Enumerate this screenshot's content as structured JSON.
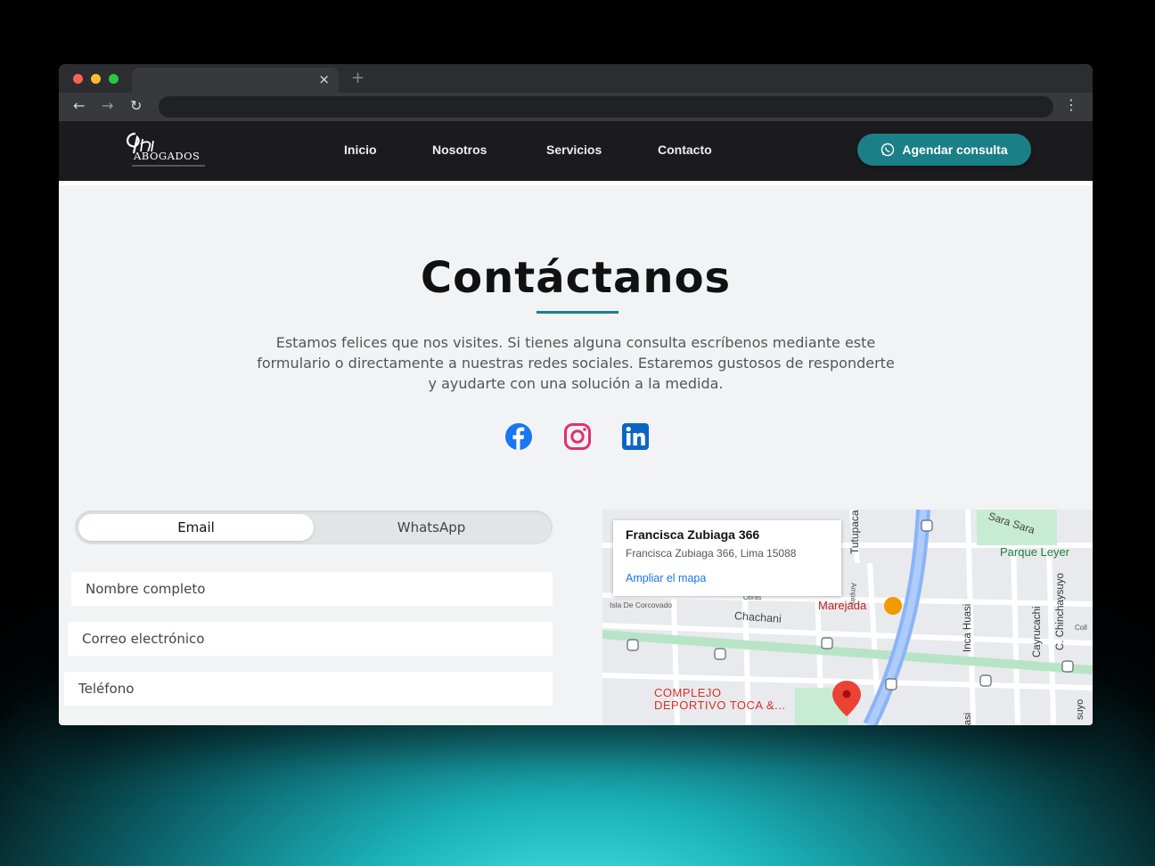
{
  "browser": {
    "tab_close": "×",
    "new_tab": "+",
    "back": "←",
    "forward": "→",
    "reload": "↻",
    "menu": "⋮"
  },
  "header": {
    "logo_text": "ABOGADOS",
    "nav": [
      "Inicio",
      "Nosotros",
      "Servicios",
      "Contacto"
    ],
    "cta_label": "Agendar consulta"
  },
  "main": {
    "title": "Contáctanos",
    "lead_lines": [
      "Estamos felices que nos visites. Si tienes alguna consulta escríbenos mediante este",
      "formulario o directamente a nuestras redes sociales. Estaremos gustosos de responderte",
      "y ayudarte con una solución a la medida."
    ],
    "social": [
      "facebook-icon",
      "instagram-icon",
      "linkedin-icon"
    ]
  },
  "form": {
    "toggle": [
      "Email",
      "WhatsApp"
    ],
    "active_tab": "Email",
    "fields": [
      "Nombre completo",
      "Correo electrónico",
      "Teléfono"
    ]
  },
  "map": {
    "place_title": "Francisca Zubiaga 366",
    "place_address": "Francisca Zubiaga 366, Lima 15088",
    "enlarge_link": "Ampliar el mapa",
    "labels": {
      "sara": "Sara Sara",
      "parque": "Parque Leyer",
      "tutupaca": "Tutupaca",
      "marejada": "Marejada",
      "chachani": "Chachani",
      "corcovado": "Isla De Corcovado",
      "ampay": "Ampay",
      "obras": "Obras",
      "inca": "Inca Huasi",
      "cayrucachi": "Cayrucachi",
      "chinchaysuyo": "C. Chinchaysuyo",
      "complejo1": "COMPLEJO",
      "complejo2": "DEPORTIVO TOCA &...",
      "col": "Coll",
      "suyo": "suyo",
      "asi": "asi"
    }
  },
  "colors": {
    "accent": "#1a7f86",
    "header_bg": "#1b1b1d",
    "facebook": "#1877f2",
    "instagram": "#e1306c",
    "linkedin": "#0a66c2"
  }
}
